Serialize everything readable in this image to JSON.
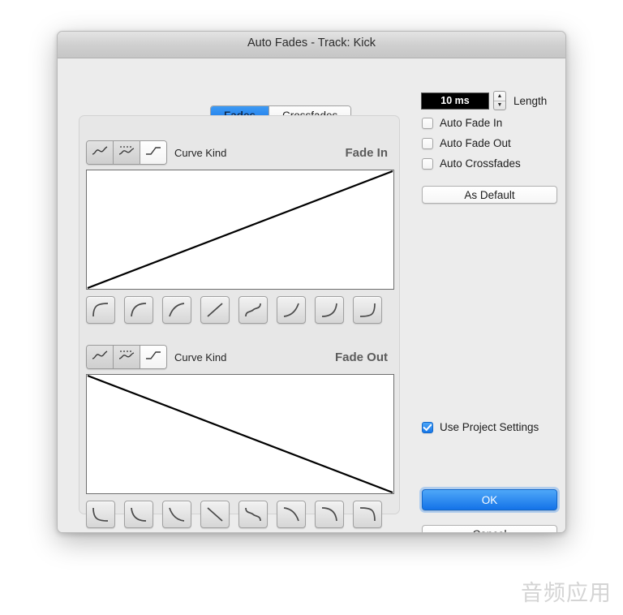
{
  "window": {
    "title": "Auto Fades - Track: Kick"
  },
  "tabs": [
    {
      "label": "Fades",
      "active": true
    },
    {
      "label": "Crossfades",
      "active": false
    }
  ],
  "fade_in": {
    "section_title": "Fade In",
    "curve_kind_label": "Curve Kind",
    "curve_kinds": [
      {
        "name": "spline-curve-icon",
        "selected": false
      },
      {
        "name": "damped-spline-curve-icon",
        "selected": false
      },
      {
        "name": "linear-curve-icon",
        "selected": true
      }
    ],
    "presets": [
      "fade-in-preset-log-steep",
      "fade-in-preset-log-medium",
      "fade-in-preset-log-shallow",
      "fade-in-preset-linear",
      "fade-in-preset-s-curve",
      "fade-in-preset-exp-shallow",
      "fade-in-preset-exp-medium",
      "fade-in-preset-exp-steep"
    ]
  },
  "fade_out": {
    "section_title": "Fade Out",
    "curve_kind_label": "Curve Kind",
    "curve_kinds": [
      {
        "name": "spline-curve-icon",
        "selected": false
      },
      {
        "name": "damped-spline-curve-icon",
        "selected": false
      },
      {
        "name": "linear-curve-icon",
        "selected": true
      }
    ],
    "presets": [
      "fade-out-preset-log-steep",
      "fade-out-preset-log-medium",
      "fade-out-preset-log-shallow",
      "fade-out-preset-linear",
      "fade-out-preset-s-curve",
      "fade-out-preset-exp-shallow",
      "fade-out-preset-exp-medium",
      "fade-out-preset-exp-steep"
    ]
  },
  "length": {
    "value": "10 ms",
    "label": "Length",
    "stepper_up": "▲",
    "stepper_down": "▼"
  },
  "options": [
    {
      "label": "Auto Fade In",
      "checked": false
    },
    {
      "label": "Auto Fade Out",
      "checked": false
    },
    {
      "label": "Auto Crossfades",
      "checked": false
    }
  ],
  "as_default_label": "As Default",
  "use_project_settings": {
    "label": "Use Project Settings",
    "checked": true
  },
  "ok_label": "OK",
  "cancel_label": "Cancel",
  "watermark": "音频应用",
  "colors": {
    "accent_blue": "#1473e8",
    "dialog_bg": "#ececec",
    "panel_bg": "#e7e7e7",
    "graph_bg": "#ffffff",
    "graph_line": "#000000",
    "field_bg": "#000000"
  },
  "chart_data": [
    {
      "type": "line",
      "title": "Fade In",
      "x": [
        0,
        1
      ],
      "y": [
        0,
        1
      ],
      "xlabel": "",
      "ylabel": "",
      "xlim": [
        0,
        1
      ],
      "ylim": [
        0,
        1
      ],
      "grid": false,
      "legend": "none",
      "curve_shape": "linear-rising"
    },
    {
      "type": "line",
      "title": "Fade Out",
      "x": [
        0,
        1
      ],
      "y": [
        1,
        0
      ],
      "xlabel": "",
      "ylabel": "",
      "xlim": [
        0,
        1
      ],
      "ylim": [
        0,
        1
      ],
      "grid": false,
      "legend": "none",
      "curve_shape": "linear-falling"
    }
  ]
}
